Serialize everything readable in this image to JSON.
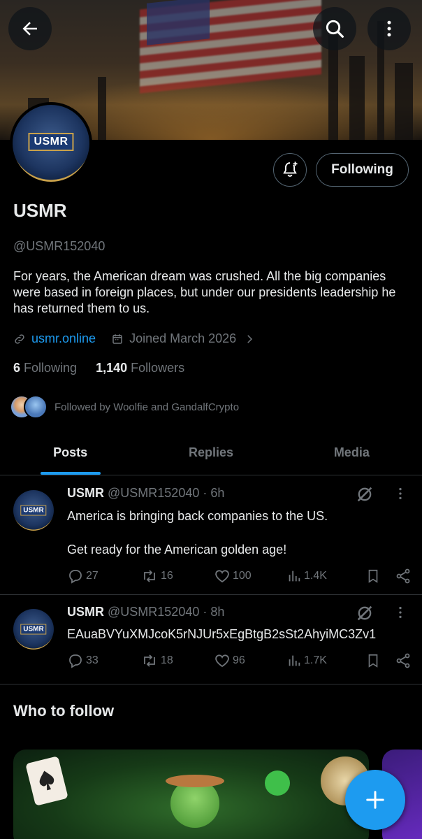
{
  "profile": {
    "name": "USMR",
    "handle": "@USMR152040",
    "bio": "For years, the American dream was crushed.   All the big companies were based in foreign places, but under our presidents leadership he has returned them to us.",
    "website": "usmr.online",
    "joined": "Joined March 2026",
    "following_count": "6",
    "following_label": "Following",
    "followers_count": "1,140",
    "followers_label": "Followers",
    "followed_by": "Followed by Woolfie and GandalfCrypto",
    "logo_text": "USMR"
  },
  "header": {
    "follow_button_label": "Following"
  },
  "tabs": [
    {
      "label": "Posts",
      "active": true
    },
    {
      "label": "Replies",
      "active": false
    },
    {
      "label": "Media",
      "active": false
    }
  ],
  "posts": [
    {
      "name": "USMR",
      "meta": "@USMR152040 · 6h",
      "text": "America is bringing back companies to the US.\n\nGet ready for the American golden age!",
      "replies": "27",
      "reposts": "16",
      "likes": "100",
      "views": "1.4K"
    },
    {
      "name": "USMR",
      "meta": "@USMR152040 · 8h",
      "text": "EAuaBVYuXMJcoK5rNJUr5xEgBtgB2sSt2AhyiMC3Zv1",
      "replies": "33",
      "reposts": "18",
      "likes": "96",
      "views": "1.7K"
    }
  ],
  "who_to_follow": {
    "title": "Who to follow"
  },
  "colors": {
    "accent": "#1d9bf0",
    "background": "#000000",
    "secondary_text": "#71767b",
    "divider": "#2f3336"
  },
  "icons": [
    "back-arrow-icon",
    "search-icon",
    "more-vertical-icon",
    "bell-plus-icon",
    "link-icon",
    "calendar-icon",
    "chevron-right-icon",
    "reply-icon",
    "repost-icon",
    "like-icon",
    "views-icon",
    "bookmark-icon",
    "share-icon",
    "grok-icon",
    "plus-icon"
  ]
}
